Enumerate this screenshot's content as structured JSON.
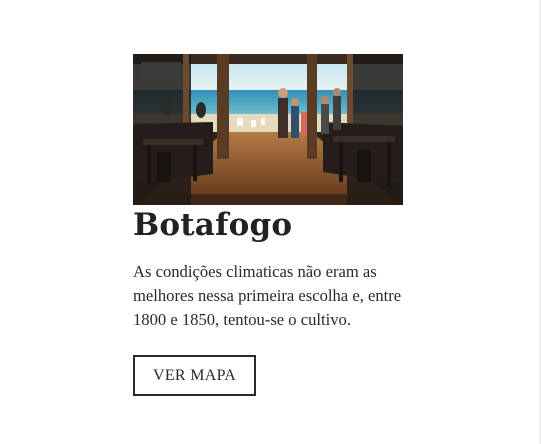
{
  "card": {
    "image_alt": "Beach restaurant terrace",
    "title": "Botafogo",
    "description": "As condições climaticas não eram as melhores nessa primeira escolha e, entre 1800 e 1850, tentou-se o cultivo.",
    "button_label": "VER MAPA"
  }
}
